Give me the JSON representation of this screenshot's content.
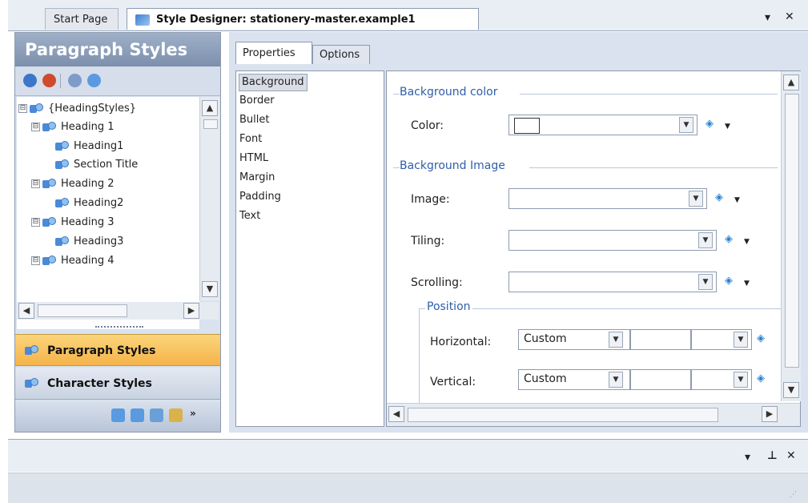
{
  "tabs": {
    "start_page": "Start Page",
    "style_designer": "Style Designer: stationery-master.example1"
  },
  "window_controls": {
    "dropdown": "▾",
    "close": "✕"
  },
  "left_panel": {
    "title": "Paragraph Styles",
    "tree": [
      {
        "label": "{HeadingStyles}",
        "expander": "⊟"
      },
      {
        "label": "Heading 1",
        "expander": "⊟"
      },
      {
        "label": "Heading1",
        "expander": ""
      },
      {
        "label": "Section Title",
        "expander": ""
      },
      {
        "label": "Heading 2",
        "expander": "⊟"
      },
      {
        "label": "Heading2",
        "expander": ""
      },
      {
        "label": "Heading 3",
        "expander": "⊟"
      },
      {
        "label": "Heading3",
        "expander": ""
      },
      {
        "label": "Heading 4",
        "expander": "⊟"
      }
    ],
    "nav": {
      "paragraph": "Paragraph Styles",
      "character": "Character Styles"
    }
  },
  "property_tabs": {
    "properties": "Properties",
    "options": "Options"
  },
  "categories": [
    "Background",
    "Border",
    "Bullet",
    "Font",
    "HTML",
    "Margin",
    "Padding",
    "Text"
  ],
  "grid": {
    "bg_color_section": "Background color",
    "color_label": "Color:",
    "bg_image_section": "Background Image",
    "image_label": "Image:",
    "tiling_label": "Tiling:",
    "scrolling_label": "Scrolling:",
    "position_section": "Position",
    "horizontal_label": "Horizontal:",
    "horizontal_value": "Custom",
    "vertical_label": "Vertical:",
    "vertical_value": "Custom"
  },
  "bottom_controls": {
    "dropdown": "▾",
    "pin": "⊥",
    "close": "✕"
  }
}
